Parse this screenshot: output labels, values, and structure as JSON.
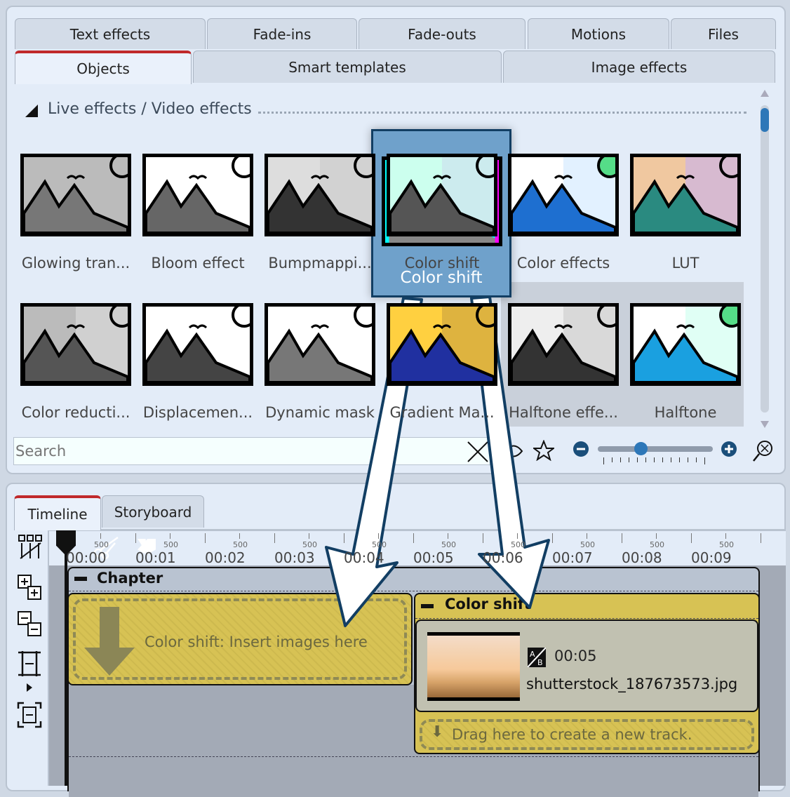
{
  "tabs_row1": [
    "Text effects",
    "Fade-ins",
    "Fade-outs",
    "Motions",
    "Files"
  ],
  "tabs_row2": [
    "Objects",
    "Smart templates",
    "Image effects"
  ],
  "active_tab": "Objects",
  "section_title": "Live effects / Video effects",
  "effects": [
    "Glowing tran...",
    "Bloom effect",
    "Bumpmappi...",
    "Color shift",
    "Color effects",
    "LUT",
    "Color reducti...",
    "Displacemen...",
    "Dynamic mask",
    "Gradient Ma...",
    "Halftone effe...",
    "Halftone"
  ],
  "drag_tile_label": "Color shift",
  "search": {
    "placeholder": "Search",
    "value": ""
  },
  "zoom_slider_value": 0.4,
  "bottom_tabs": [
    "Timeline",
    "Storyboard"
  ],
  "active_bottom_tab": "Timeline",
  "ruler": {
    "labels": [
      "00:00",
      "00:01",
      "00:02",
      "00:03",
      "00:04",
      "00:05",
      "00:06",
      "00:07",
      "00:08",
      "00:09"
    ],
    "sub_label": "500"
  },
  "chapter": {
    "title": "Chapter",
    "placeholder": "Color shift: Insert images here"
  },
  "effect_block": {
    "title": "Color shift",
    "duration": "00:05",
    "filename": "shutterstock_187673573.jpg",
    "drop_hint": "Drag here to create a new track."
  },
  "colors": {
    "accent_tab": "#c0292b",
    "highlight_blue": "#6fa1cb",
    "track_yellow": "#d7c254",
    "arrow_outline": "#123e63"
  }
}
